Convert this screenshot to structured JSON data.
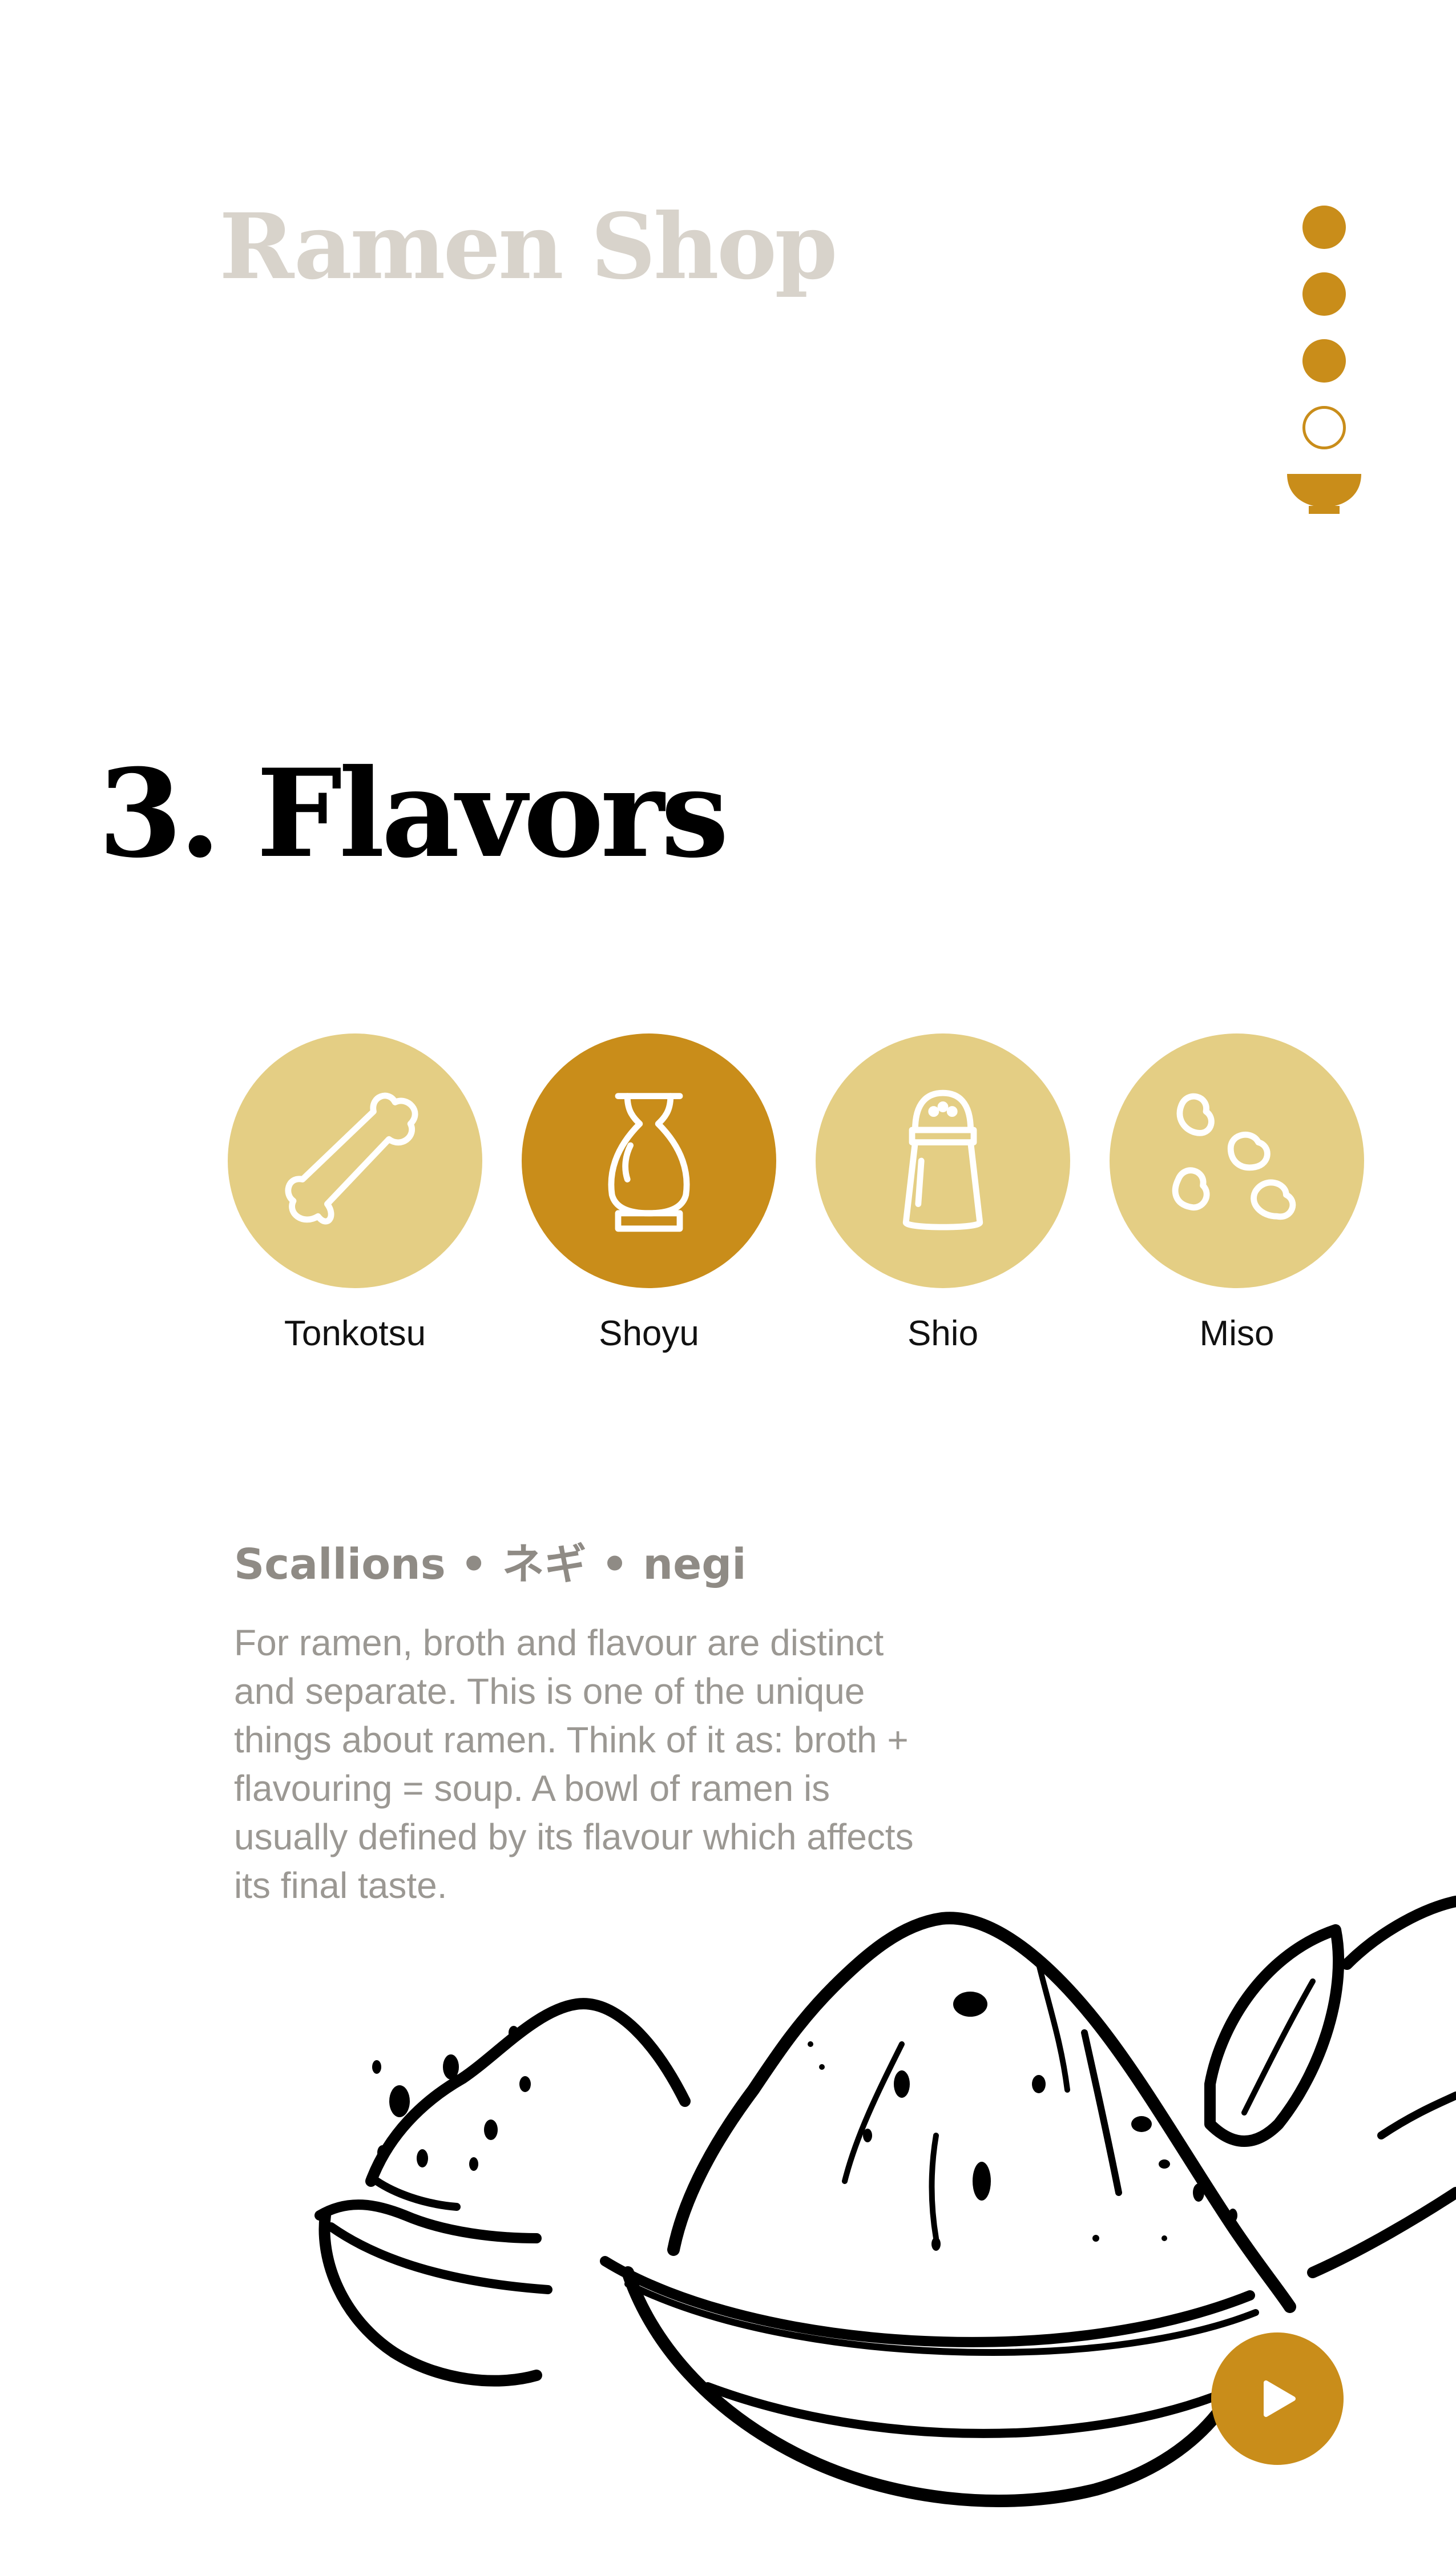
{
  "header": {
    "brand": "Ramen Shop"
  },
  "progress": {
    "total_steps": 4,
    "completed_steps": 3,
    "accent_color": "#c98d1a"
  },
  "section": {
    "title": "3. Flavors"
  },
  "flavors": {
    "items": [
      {
        "label": "Tonkotsu",
        "icon": "bone-icon",
        "selected": false
      },
      {
        "label": "Shoyu",
        "icon": "soy-sauce-bottle-icon",
        "selected": true
      },
      {
        "label": "Shio",
        "icon": "salt-shaker-icon",
        "selected": false
      },
      {
        "label": "Miso",
        "icon": "beans-icon",
        "selected": false
      }
    ],
    "color_default": "#e4ce84",
    "color_selected": "#c98d1a"
  },
  "info": {
    "title": "Scallions • ネギ • negi",
    "body": "For ramen, broth and flavour are distinct and separate. This is one of the unique things about ramen. Think of it as: broth + flavouring = soup. A bowl of ramen is usually defined by its flavour which affects its final taste."
  },
  "play_button": {
    "icon": "play-icon"
  }
}
